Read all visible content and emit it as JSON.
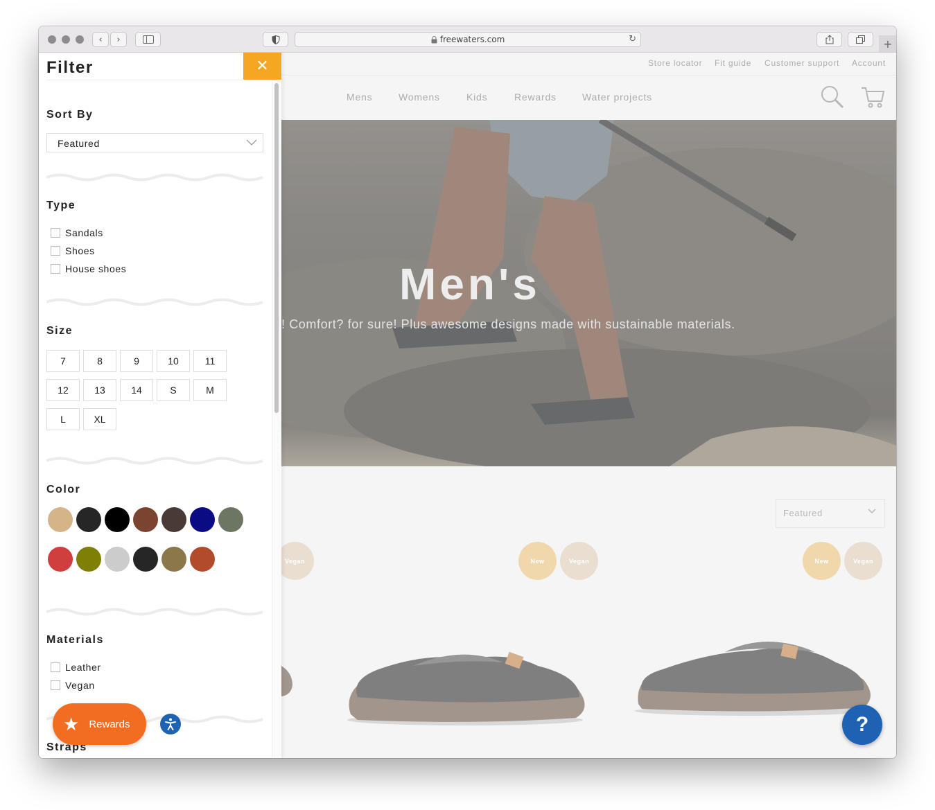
{
  "browser": {
    "url": "freewaters.com",
    "back_glyph": "‹",
    "forward_glyph": "›",
    "reload_glyph": "↻",
    "newtab_glyph": "+"
  },
  "site": {
    "top_links": [
      "Store locator",
      "Fit guide",
      "Customer support",
      "Account"
    ],
    "main_nav": [
      "Mens",
      "Womens",
      "Kids",
      "Rewards",
      "Water projects"
    ],
    "hero": {
      "title": "Men's",
      "subtitle": "!  Comfort? for sure! Plus awesome designs made with sustainable materials."
    },
    "sort_select": {
      "value": "Featured"
    },
    "badges": {
      "new": "New",
      "vegan": "Vegan"
    },
    "help_glyph": "?"
  },
  "filter": {
    "title": "Filter",
    "close_glyph": "✕",
    "sort_by": {
      "heading": "Sort By",
      "value": "Featured"
    },
    "type": {
      "heading": "Type",
      "options": [
        "Sandals",
        "Shoes",
        "House shoes"
      ]
    },
    "size": {
      "heading": "Size",
      "options": [
        "7",
        "8",
        "9",
        "10",
        "11",
        "12",
        "13",
        "14",
        "S",
        "M",
        "L",
        "XL"
      ]
    },
    "color": {
      "heading": "Color",
      "swatches": [
        "#d4b488",
        "#262626",
        "#000000",
        "#7b4430",
        "#4a3a36",
        "#0b0c83",
        "#6d7563",
        "#cf3f3d",
        "#7f7f06",
        "#cccccc",
        "#262626",
        "#8a774a",
        "#b24a2c"
      ]
    },
    "materials": {
      "heading": "Materials",
      "options": [
        "Leather",
        "Vegan"
      ]
    },
    "straps": {
      "heading": "Straps"
    }
  },
  "widgets": {
    "rewards_label": "Rewards"
  },
  "colors": {
    "accent": "#f5a623",
    "rewards": "#f26d21",
    "help_blue": "#1d62b3"
  }
}
